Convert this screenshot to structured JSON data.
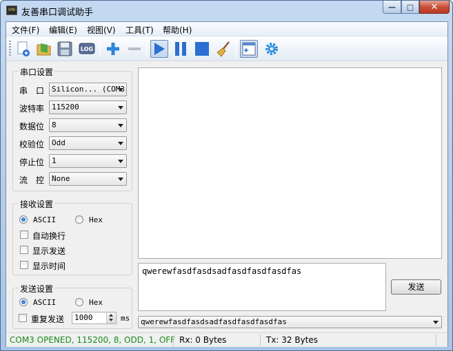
{
  "window": {
    "title": "友善串口调试助手",
    "app_icon_text": "SMU"
  },
  "window_buttons": {
    "minimize": "—",
    "maximize": "□",
    "close": "✕"
  },
  "menu": [
    {
      "label": "文件(F)"
    },
    {
      "label": "编辑(E)"
    },
    {
      "label": "视图(V)"
    },
    {
      "label": "工具(T)"
    },
    {
      "label": "帮助(H)"
    }
  ],
  "toolbar": {
    "log_label": "LOG"
  },
  "serial_settings": {
    "title": "串口设置",
    "port": {
      "label": "串　口",
      "value": "Silicon... (COM3"
    },
    "baud": {
      "label": "波特率",
      "value": "115200"
    },
    "databits": {
      "label": "数据位",
      "value": "8"
    },
    "parity": {
      "label": "校验位",
      "value": "Odd"
    },
    "stopbits": {
      "label": "停止位",
      "value": "1"
    },
    "flow": {
      "label": "流　控",
      "value": "None"
    }
  },
  "receive_settings": {
    "title": "接收设置",
    "ascii_label": "ASCII",
    "hex_label": "Hex",
    "auto_newline": "自动换行",
    "show_send": "显示发送",
    "show_time": "显示时间"
  },
  "send_settings": {
    "title": "发送设置",
    "ascii_label": "ASCII",
    "hex_label": "Hex",
    "repeat_label": "重复发送",
    "interval_value": "1000",
    "interval_unit": "ms"
  },
  "send_box": {
    "text": "qwerewfasdfasdsadfasdfasdfasdfas"
  },
  "send_button": {
    "label": "发送"
  },
  "history": {
    "value": "qwerewfasdfasdsadfasdfasdfasdfas"
  },
  "status": {
    "connection": "COM3 OPENED, 115200, 8, ODD, 1, OFF",
    "rx": "Rx: 0 Bytes",
    "tx": "Tx: 32 Bytes"
  },
  "colors": {
    "status_ok": "#1a8a1a"
  }
}
